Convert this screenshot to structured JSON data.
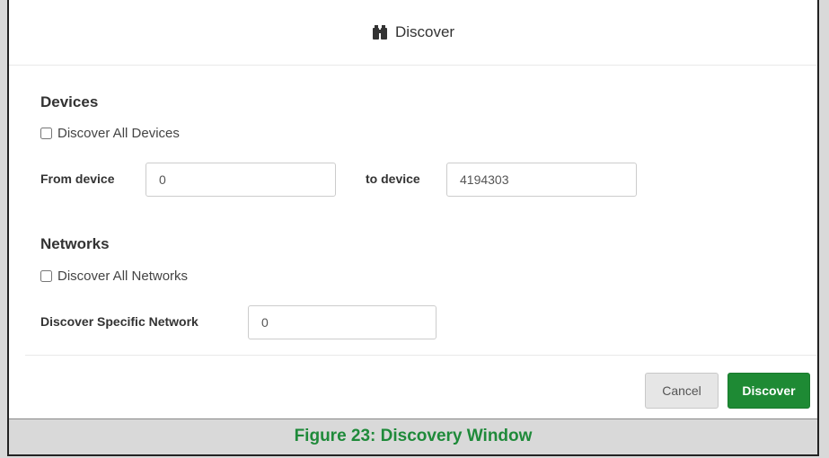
{
  "header": {
    "title": "Discover",
    "icon": "binoculars-icon"
  },
  "devices": {
    "title": "Devices",
    "discover_all_label": "Discover All Devices",
    "discover_all_checked": false,
    "from_label": "From device",
    "from_value": "0",
    "to_label": "to device",
    "to_value": "4194303"
  },
  "networks": {
    "title": "Networks",
    "discover_all_label": "Discover All Networks",
    "discover_all_checked": false,
    "specific_label": "Discover Specific Network",
    "specific_value": "0"
  },
  "footer": {
    "cancel_label": "Cancel",
    "discover_label": "Discover"
  },
  "caption": "Figure 23: Discovery Window",
  "colors": {
    "primary_button": "#1e8a34",
    "caption_text": "#1f8a3a"
  }
}
